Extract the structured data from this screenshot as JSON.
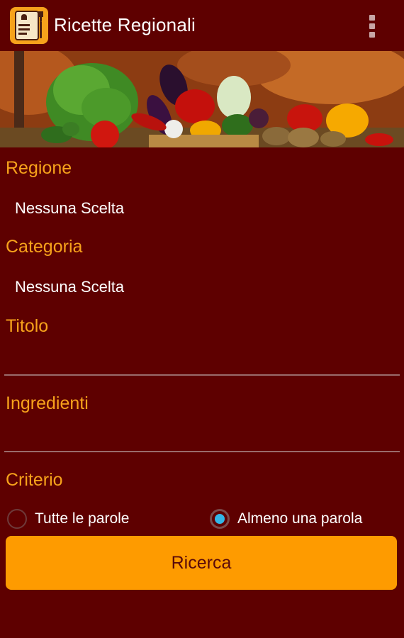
{
  "app": {
    "title": "Ricette Regionali"
  },
  "form": {
    "regione": {
      "label": "Regione",
      "value": "Nessuna Scelta"
    },
    "categoria": {
      "label": "Categoria",
      "value": "Nessuna Scelta"
    },
    "titolo": {
      "label": "Titolo",
      "value": ""
    },
    "ingredienti": {
      "label": "Ingredienti",
      "value": ""
    },
    "criterio": {
      "label": "Criterio",
      "options": [
        {
          "label": "Tutte le parole",
          "selected": false
        },
        {
          "label": "Almeno una parola",
          "selected": true
        }
      ]
    },
    "search_button": "Ricerca"
  },
  "icons": {
    "app_icon": "recipe-book-icon",
    "overflow": "overflow-menu-icon"
  },
  "colors": {
    "background": "#5e0000",
    "accent": "#f7a21b",
    "button": "#fe9b00",
    "radio_selected": "#33b5e5"
  }
}
